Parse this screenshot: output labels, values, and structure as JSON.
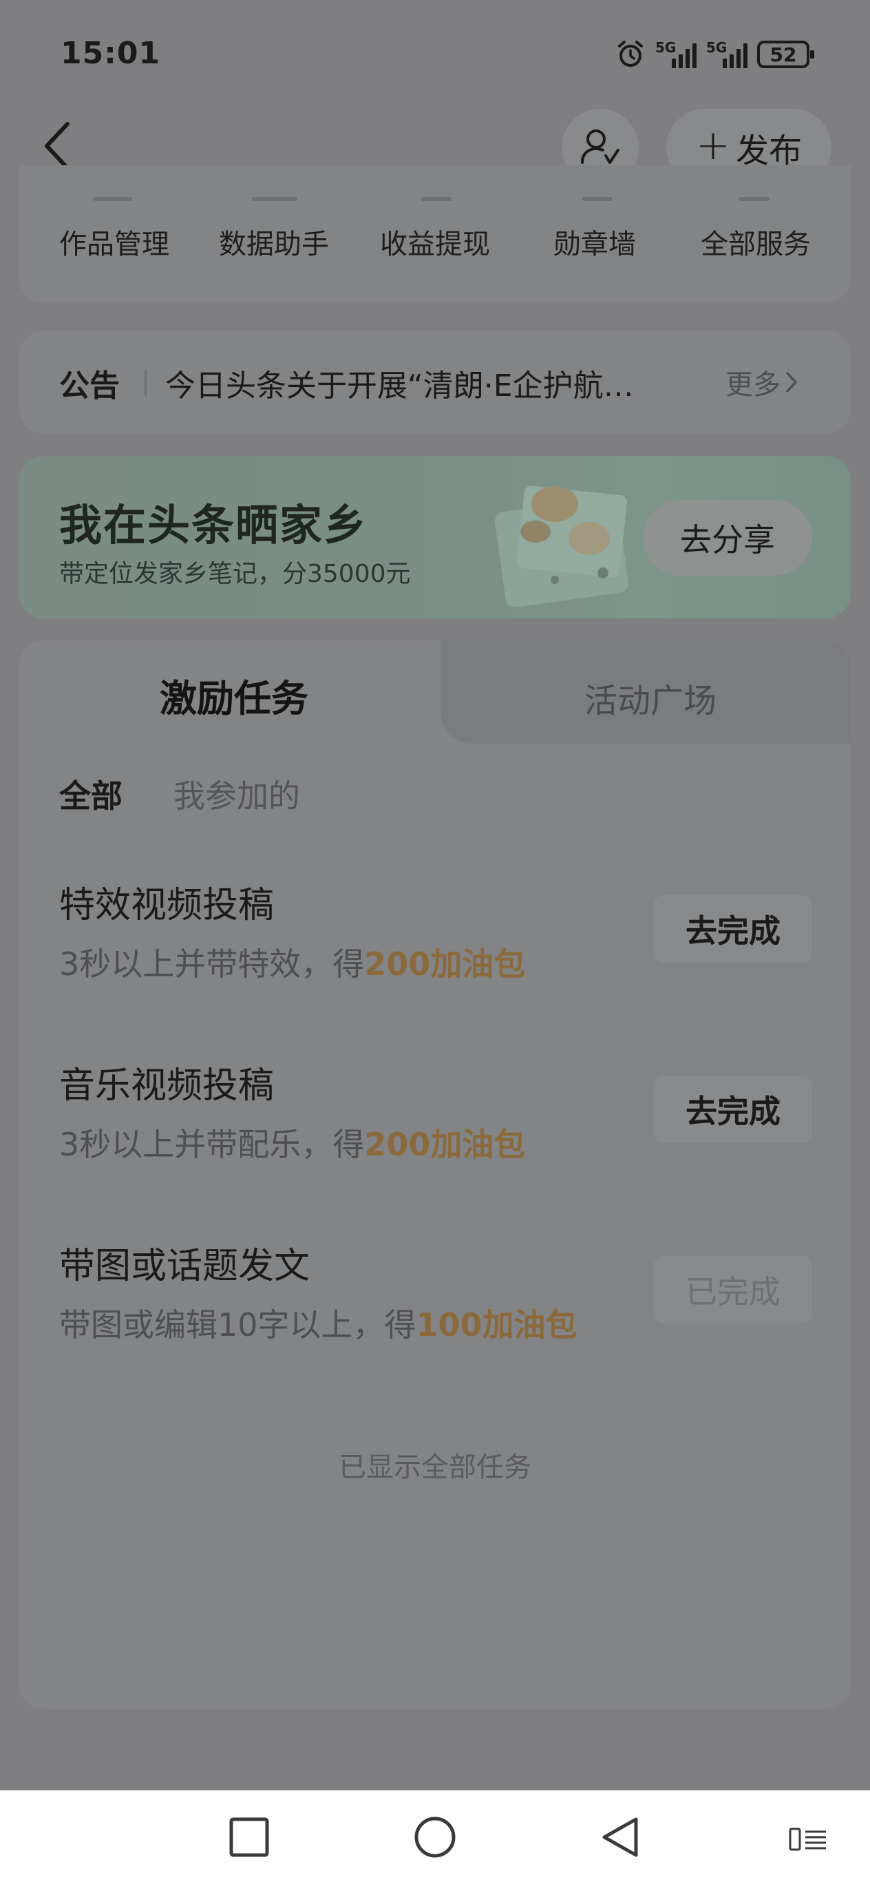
{
  "status_bar": {
    "time": "15:01",
    "signal1_label": "5G",
    "signal2_label": "5G",
    "battery": "52"
  },
  "header": {
    "back_icon": "chevron-left-icon",
    "user_icon": "user-check-icon",
    "publish_label": "发布"
  },
  "services": {
    "items": [
      "作品管理",
      "数据助手",
      "收益提现",
      "勋章墙",
      "全部服务"
    ]
  },
  "notice": {
    "label": "公告",
    "text": "今日头条关于开展“清朗·E企护航…",
    "more": "更多"
  },
  "banner": {
    "title": "我在头条晒家乡",
    "subtitle": "带定位发家乡笔记，分35000元",
    "button": "去分享"
  },
  "tabs": {
    "active": "激励任务",
    "inactive": "活动广场"
  },
  "filters": {
    "all": "全部",
    "mine": "我参加的"
  },
  "tasks": [
    {
      "title": "特效视频投稿",
      "desc_prefix": "3秒以上并带特效，得",
      "reward": "200加油包",
      "button": "去完成",
      "done": false
    },
    {
      "title": "音乐视频投稿",
      "desc_prefix": "3秒以上并带配乐，得",
      "reward": "200加油包",
      "button": "去完成",
      "done": false
    },
    {
      "title": "带图或话题发文",
      "desc_prefix": "带图或编辑10字以上，得",
      "reward": "100加油包",
      "button": "已完成",
      "done": true
    }
  ],
  "footer_text": "已显示全部任务",
  "colors": {
    "overlay_bg": "#7f7f81",
    "card_bg": "#838486",
    "reward_color": "#8a6a3c",
    "nav_bg": "#ffffff"
  }
}
